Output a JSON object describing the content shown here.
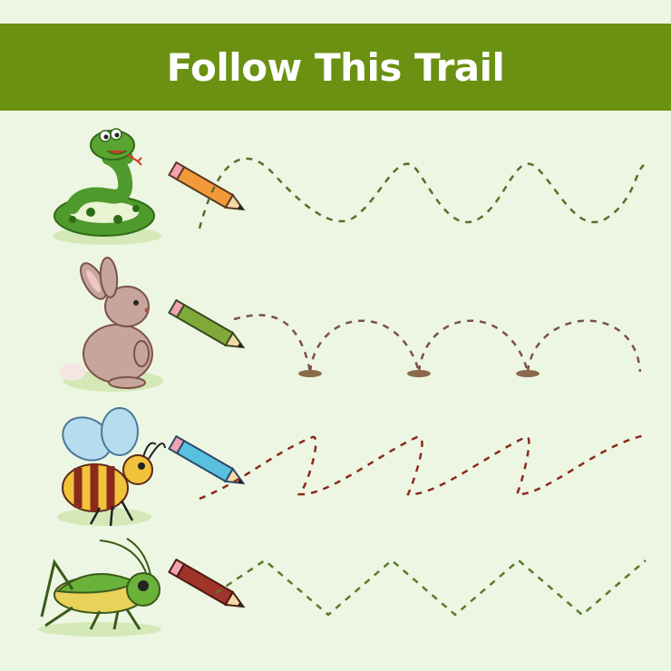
{
  "title": "Follow This Trail",
  "colors": {
    "banner": "#6a9112",
    "background": "#edf6e2",
    "title_text": "#ffffff"
  },
  "rows": [
    {
      "animal": "snake",
      "icon": "snake-icon",
      "pencil": "orange-pencil-icon",
      "trail": "wave",
      "trail_color": "#5a6e2c"
    },
    {
      "animal": "rabbit",
      "icon": "rabbit-icon",
      "pencil": "green-pencil-icon",
      "trail": "hops",
      "trail_color": "#7a5248"
    },
    {
      "animal": "bee",
      "icon": "bee-icon",
      "pencil": "blue-pencil-icon",
      "trail": "zigzag",
      "trail_color": "#8a2a1c"
    },
    {
      "animal": "grasshopper",
      "icon": "grasshopper-icon",
      "pencil": "red-pencil-icon",
      "trail": "zigzag-sharp",
      "trail_color": "#5a7a2a"
    }
  ]
}
